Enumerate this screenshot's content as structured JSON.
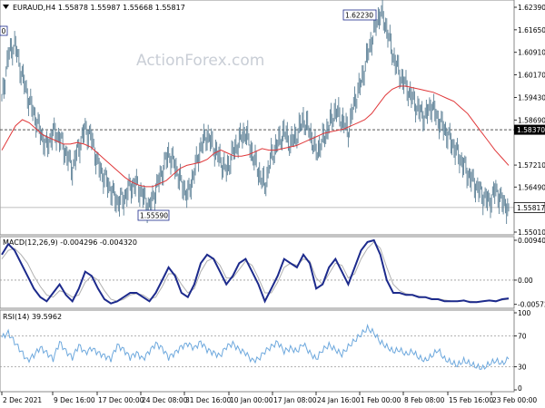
{
  "watermark": "ActionForex.com",
  "colors": {
    "price": "#5b7f95",
    "ma": "#e0383a",
    "macd": "#1c2a8c",
    "signal": "#b0b0b0",
    "rsi": "#6da8dd",
    "level": "#555555",
    "grid": "#9a9a9a"
  },
  "price_panel": {
    "header": "EURAUD,H4  1.55878 1.55987 1.55668 1.55817",
    "y_ticks": [
      "1.62390",
      "1.61650",
      "1.60910",
      "1.60170",
      "1.59430",
      "1.58690",
      "1.57210",
      "1.56490",
      "1.55010"
    ],
    "y_tick_values": [
      1.6239,
      1.6165,
      1.6091,
      1.6017,
      1.5943,
      1.5869,
      1.5721,
      1.5649,
      1.5501
    ],
    "level_value": 1.5837,
    "level_label": "1.58370",
    "last_value": 1.55817,
    "last_label": "1.55817",
    "high_label": "1.62230",
    "high_value": 1.6223,
    "low_label": "1.55590",
    "low_value": 1.5559,
    "left_box_label": "0"
  },
  "macd_panel": {
    "header": "MACD(12,26,9) -0.004296 -0.004320",
    "y_ticks": [
      "0.009407",
      "0.00",
      "-0.005726"
    ],
    "y_tick_values": [
      0.009407,
      0,
      -0.005726
    ]
  },
  "rsi_panel": {
    "header": "RSI(14) 39.5962",
    "y_ticks": [
      "100",
      "70",
      "30",
      "0"
    ],
    "y_tick_values": [
      100,
      70,
      30,
      0
    ]
  },
  "x_axis": {
    "labels": [
      "2 Dec 2021",
      "9 Dec 16:00",
      "17 Dec 00:00",
      "24 Dec 08:00",
      "31 Dec 16:00",
      "10 Jan 00:00",
      "17 Jan 08:00",
      "24 Jan 16:00",
      "1 Feb 00:00",
      "8 Feb 08:00",
      "15 Feb 16:00",
      "23 Feb 00:00"
    ]
  },
  "chart_data": {
    "type": "line",
    "x_labels": [
      "2 Dec 2021",
      "9 Dec 16:00",
      "17 Dec 00:00",
      "24 Dec 08:00",
      "31 Dec 16:00",
      "10 Jan 00:00",
      "17 Jan 08:00",
      "24 Jan 16:00",
      "1 Feb 00:00",
      "8 Feb 08:00",
      "15 Feb 16:00",
      "23 Feb 00:00"
    ],
    "series": [
      {
        "name": "EURAUD,H4",
        "values": [
          1.593,
          1.608,
          1.612,
          1.603,
          1.595,
          1.589,
          1.583,
          1.578,
          1.583,
          1.581,
          1.576,
          1.571,
          1.578,
          1.584,
          1.581,
          1.572,
          1.568,
          1.564,
          1.56,
          1.561,
          1.565,
          1.566,
          1.562,
          1.558,
          1.564,
          1.57,
          1.576,
          1.572,
          1.566,
          1.562,
          1.57,
          1.578,
          1.582,
          1.578,
          1.574,
          1.57,
          1.576,
          1.58,
          1.583,
          1.576,
          1.57,
          1.565,
          1.575,
          1.579,
          1.583,
          1.579,
          1.582,
          1.587,
          1.583,
          1.576,
          1.58,
          1.585,
          1.59,
          1.587,
          1.583,
          1.593,
          1.599,
          1.608,
          1.616,
          1.6223,
          1.617,
          1.608,
          1.602,
          1.598,
          1.594,
          1.59,
          1.588,
          1.592,
          1.587,
          1.584,
          1.58,
          1.576,
          1.572,
          1.568,
          1.565,
          1.562,
          1.56,
          1.564,
          1.56,
          1.5582
        ]
      },
      {
        "name": "MA",
        "values": [
          1.577,
          1.581,
          1.585,
          1.587,
          1.586,
          1.584,
          1.582,
          1.581,
          1.58,
          1.579,
          1.579,
          1.5795,
          1.579,
          1.578,
          1.576,
          1.574,
          1.572,
          1.57,
          1.568,
          1.5665,
          1.5655,
          1.565,
          1.565,
          1.566,
          1.567,
          1.569,
          1.571,
          1.572,
          1.5725,
          1.573,
          1.574,
          1.576,
          1.577,
          1.576,
          1.575,
          1.575,
          1.5755,
          1.5765,
          1.5775,
          1.577,
          1.577,
          1.5775,
          1.578,
          1.5785,
          1.5795,
          1.5805,
          1.5815,
          1.5825,
          1.583,
          1.5835,
          1.584,
          1.585,
          1.586,
          1.587,
          1.589,
          1.592,
          1.595,
          1.597,
          1.598,
          1.598,
          1.5975,
          1.597,
          1.5965,
          1.596,
          1.595,
          1.594,
          1.593,
          1.591,
          1.589,
          1.586,
          1.583,
          1.58,
          1.577,
          1.5745,
          1.572
        ]
      }
    ],
    "macd": {
      "macd_values": [
        0.006,
        0.0085,
        0.007,
        0.004,
        0.001,
        -0.002,
        -0.004,
        -0.005,
        -0.003,
        -0.001,
        -0.0035,
        -0.005,
        -0.002,
        0.002,
        0.001,
        -0.002,
        -0.0045,
        -0.0055,
        -0.005,
        -0.004,
        -0.003,
        -0.003,
        -0.004,
        -0.005,
        -0.003,
        0.0,
        0.003,
        0.001,
        -0.003,
        -0.004,
        -0.001,
        0.004,
        0.006,
        0.005,
        0.002,
        -0.001,
        0.001,
        0.004,
        0.005,
        0.002,
        -0.001,
        -0.005,
        -0.002,
        0.001,
        0.005,
        0.004,
        0.003,
        0.006,
        0.004,
        -0.002,
        -0.001,
        0.003,
        0.005,
        0.002,
        -0.001,
        0.003,
        0.007,
        0.009,
        0.0094,
        0.006,
        0.0,
        -0.003,
        -0.003,
        -0.0035,
        -0.0035,
        -0.004,
        -0.004,
        -0.0045,
        -0.0045,
        -0.005,
        -0.005,
        -0.005,
        -0.0048,
        -0.0052,
        -0.0052,
        -0.005,
        -0.0048,
        -0.005,
        -0.0045,
        -0.0043
      ],
      "signal_values": [
        0.005,
        0.007,
        0.0075,
        0.006,
        0.004,
        0.001,
        -0.0015,
        -0.0035,
        -0.004,
        -0.0025,
        -0.003,
        -0.004,
        -0.0035,
        -0.0005,
        0.001,
        0.0,
        -0.0025,
        -0.0045,
        -0.005,
        -0.0045,
        -0.0035,
        -0.0032,
        -0.0035,
        -0.0045,
        -0.004,
        -0.0015,
        0.0015,
        0.0015,
        -0.001,
        -0.003,
        -0.002,
        0.002,
        0.0045,
        0.0052,
        0.0035,
        0.0005,
        0.0005,
        0.0025,
        0.0045,
        0.0035,
        0.0005,
        -0.003,
        -0.003,
        -0.0005,
        0.003,
        0.004,
        0.0035,
        0.005,
        0.0045,
        0.0005,
        -0.001,
        0.0015,
        0.004,
        0.0035,
        0.0005,
        0.0015,
        0.005,
        0.0075,
        0.009,
        0.0075,
        0.003,
        -0.001,
        -0.0025,
        -0.0032,
        -0.0035,
        -0.0038,
        -0.004,
        -0.0043,
        -0.0044,
        -0.0047,
        -0.0049,
        -0.005,
        -0.0049,
        -0.005,
        -0.0051,
        -0.005,
        -0.0049,
        -0.0049,
        -0.0047,
        -0.0045
      ]
    },
    "rsi": {
      "values": [
        68,
        74,
        62,
        50,
        38,
        45,
        55,
        48,
        40,
        62,
        50,
        42,
        58,
        48,
        54,
        48,
        44,
        40,
        58,
        52,
        42,
        48,
        40,
        50,
        60,
        54,
        42,
        48,
        56,
        60,
        54,
        62,
        52,
        48,
        44,
        56,
        60,
        52,
        48,
        38,
        40,
        50,
        56,
        62,
        50,
        54,
        50,
        60,
        48,
        40,
        52,
        58,
        52,
        46,
        56,
        64,
        72,
        80,
        74,
        62,
        56,
        50,
        52,
        46,
        50,
        42,
        38,
        44,
        52,
        40,
        36,
        32,
        38,
        34,
        30,
        28,
        34,
        38,
        34,
        40
      ]
    }
  }
}
